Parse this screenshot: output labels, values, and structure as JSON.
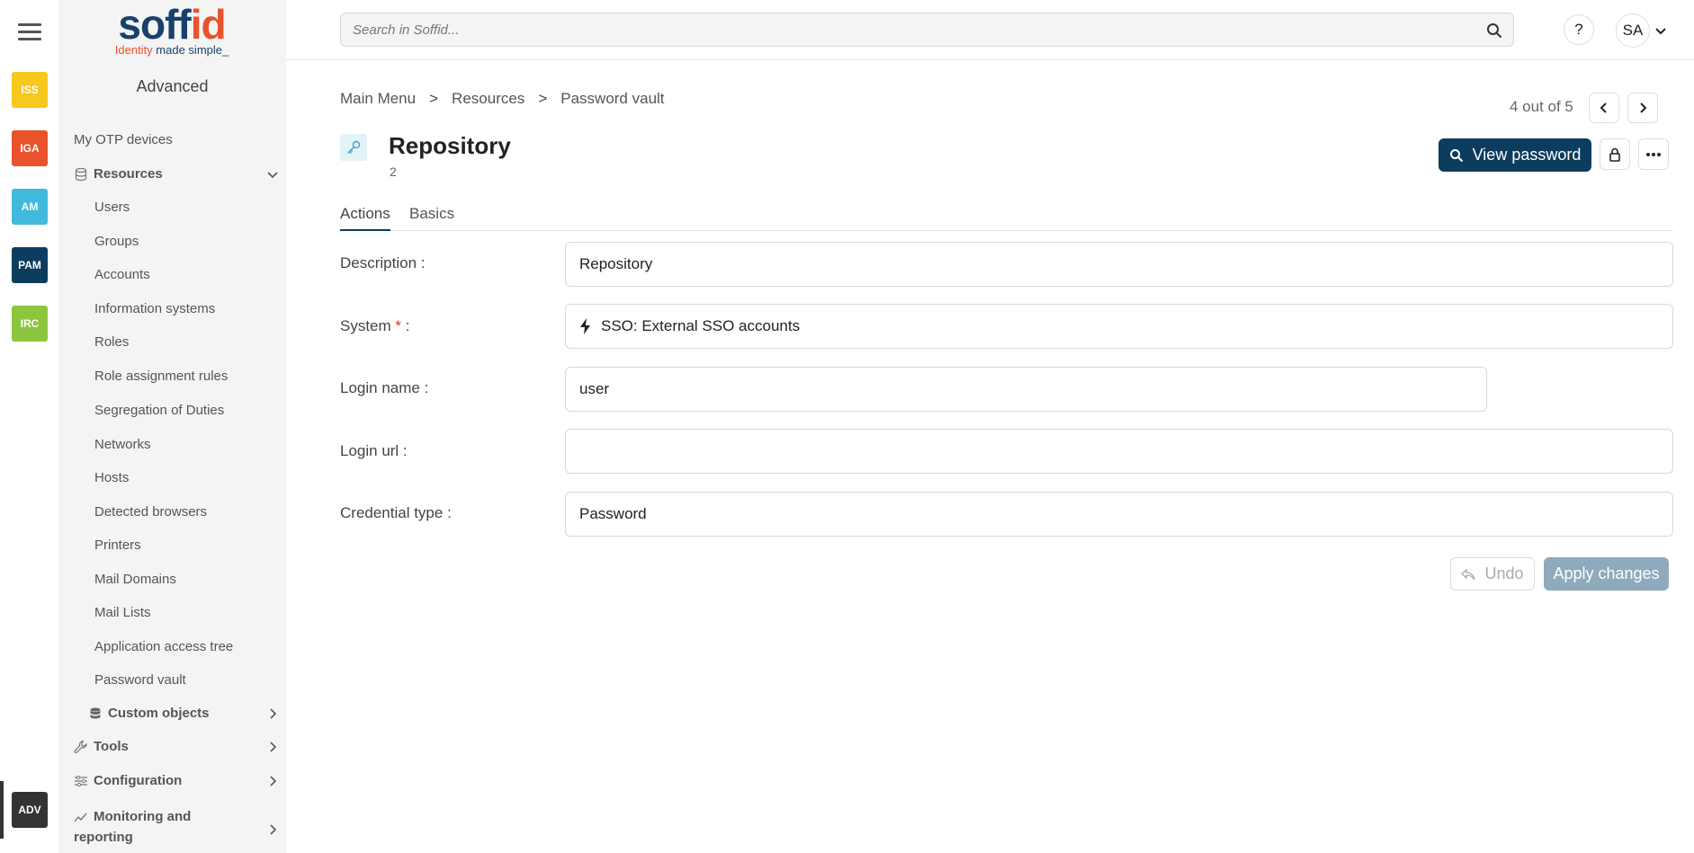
{
  "rail": {
    "apps": [
      {
        "label": "ISS",
        "color": "#f7c81e"
      },
      {
        "label": "IGA",
        "color": "#e9522b"
      },
      {
        "label": "AM",
        "color": "#3fb9dc"
      },
      {
        "label": "PAM",
        "color": "#0d3d5e"
      },
      {
        "label": "IRC",
        "color": "#8cc63f"
      }
    ],
    "active_app": {
      "label": "ADV",
      "color": "#333333"
    }
  },
  "logo": {
    "word_a": "soff",
    "word_b": "id",
    "tag_a": "Identity ",
    "tag_b": "made simple_"
  },
  "sidemenu": {
    "title": "Advanced",
    "otp": "My OTP devices",
    "resources": {
      "label": "Resources",
      "items": [
        "Users",
        "Groups",
        "Accounts",
        "Information systems",
        "Roles",
        "Role assignment rules",
        "Segregation of Duties",
        "Networks",
        "Hosts",
        "Detected browsers",
        "Printers",
        "Mail Domains",
        "Mail Lists",
        "Application access tree",
        "Password vault"
      ]
    },
    "custom_objects": "Custom objects",
    "tools": "Tools",
    "configuration": "Configuration",
    "monitoring_a": "Monitoring and",
    "monitoring_b": "reporting"
  },
  "topbar": {
    "search_placeholder": "Search in Soffid...",
    "help": "?",
    "avatar": "SA"
  },
  "breadcrumb": [
    "Main Menu",
    "Resources",
    "Password vault"
  ],
  "breadcrumb_sep": ">",
  "pager": {
    "text": "4 out of 5"
  },
  "object": {
    "title": "Repository",
    "subtitle": "2"
  },
  "buttons": {
    "view_password": "View password",
    "undo": "Undo",
    "apply": "Apply changes"
  },
  "tabs": [
    {
      "label": "Actions",
      "active": true
    },
    {
      "label": "Basics",
      "active": false
    }
  ],
  "form": {
    "description": {
      "label": "Description :",
      "value": "Repository"
    },
    "system": {
      "label": "System",
      "required_mark": "*",
      "suffix": " :",
      "value": "SSO: External SSO accounts"
    },
    "login_name": {
      "label": "Login name :",
      "value": "user"
    },
    "login_url": {
      "label": "Login url :",
      "value": ""
    },
    "credential_type": {
      "label": "Credential type :",
      "value": "Password"
    }
  }
}
